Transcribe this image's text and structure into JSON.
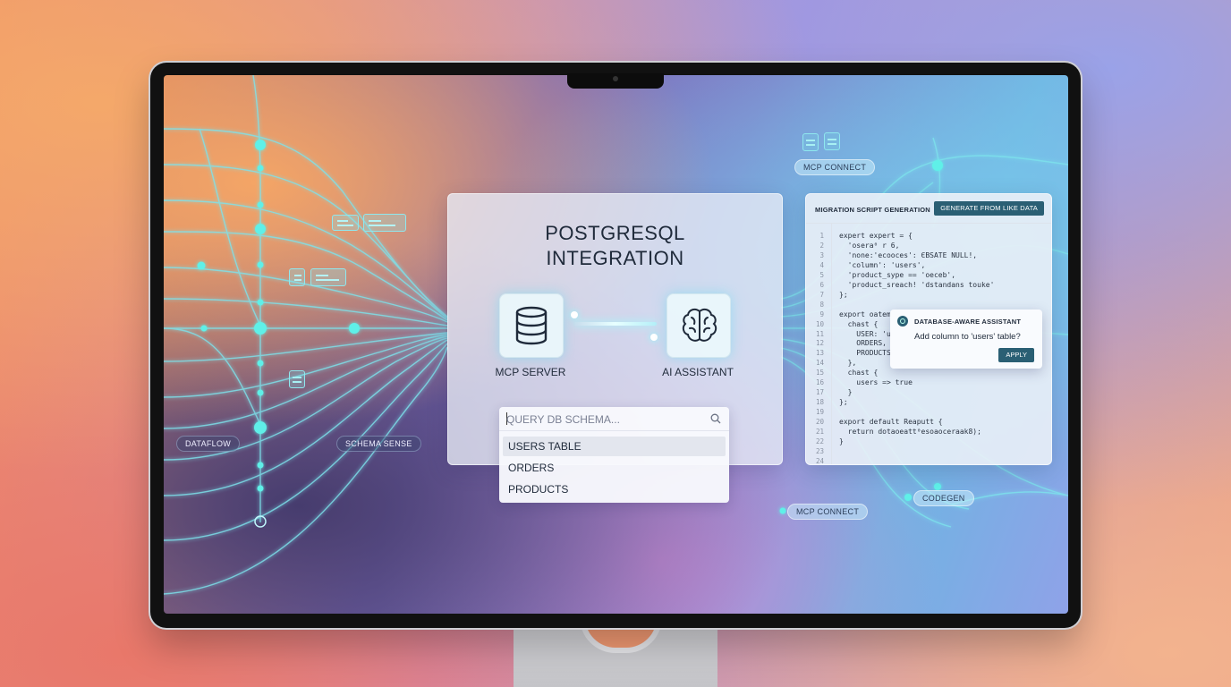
{
  "center": {
    "title_line1": "POSTGRESQL",
    "title_line2": "INTEGRATION",
    "left_tile_label": "MCP SERVER",
    "right_tile_label": "AI ASSISTANT",
    "left_tile_icon": "database-icon",
    "right_tile_icon": "brain-icon"
  },
  "query": {
    "placeholder": "QUERY DB SCHEMA...",
    "icon": "search-icon",
    "items": [
      "USERS TABLE",
      "ORDERS",
      "PRODUCTS"
    ],
    "selected": "USERS TABLE"
  },
  "tags": {
    "dataflow": "DATAFLOW",
    "schema_sense": "SCHEMA SENSE",
    "mcp_connect_top": "MCP CONNECT",
    "mcp_connect_bottom": "MCP CONNECT",
    "codegen": "CODEGEN"
  },
  "code_panel": {
    "title": "MIGRATION SCRIPT GENERATION",
    "button": "GENERATE FROM LIKE DATA",
    "line_numbers": [
      "1",
      "2",
      "3",
      "4",
      "5",
      "6",
      "7",
      "8",
      "9",
      "10",
      "11",
      "12",
      "13",
      "14",
      "15",
      "16",
      "17",
      "18",
      "19",
      "20",
      "21",
      "22",
      "23",
      "24"
    ],
    "lines": [
      "expert expert = {",
      "  'osera⁰ r 6,",
      "  'none:'ecooces': ЄBSATE NULL!,",
      "  'column': 'users',",
      "  'product_sype == 'oeceb',",
      "  'product_sreach! 'dstandans touke'",
      "};",
      "",
      "export oatem",
      "  chast {",
      "    USER: 'u",
      "    ORDERS,",
      "    PRODUCTS",
      "  },",
      "  chast {",
      "    users => true",
      "  }",
      "};",
      "",
      "export default Reaputt {",
      "  return dotaoeatt⁰esoaoceraak8);",
      "}",
      "",
      ""
    ]
  },
  "assistant_popup": {
    "title": "DATABASE-AWARE ASSISTANT",
    "message": "Add column to 'users' table?",
    "button": "APPLY"
  },
  "colors": {
    "accent": "#2a5f74",
    "flow_line": "#7de3ec",
    "node": "#5ff0e8"
  }
}
